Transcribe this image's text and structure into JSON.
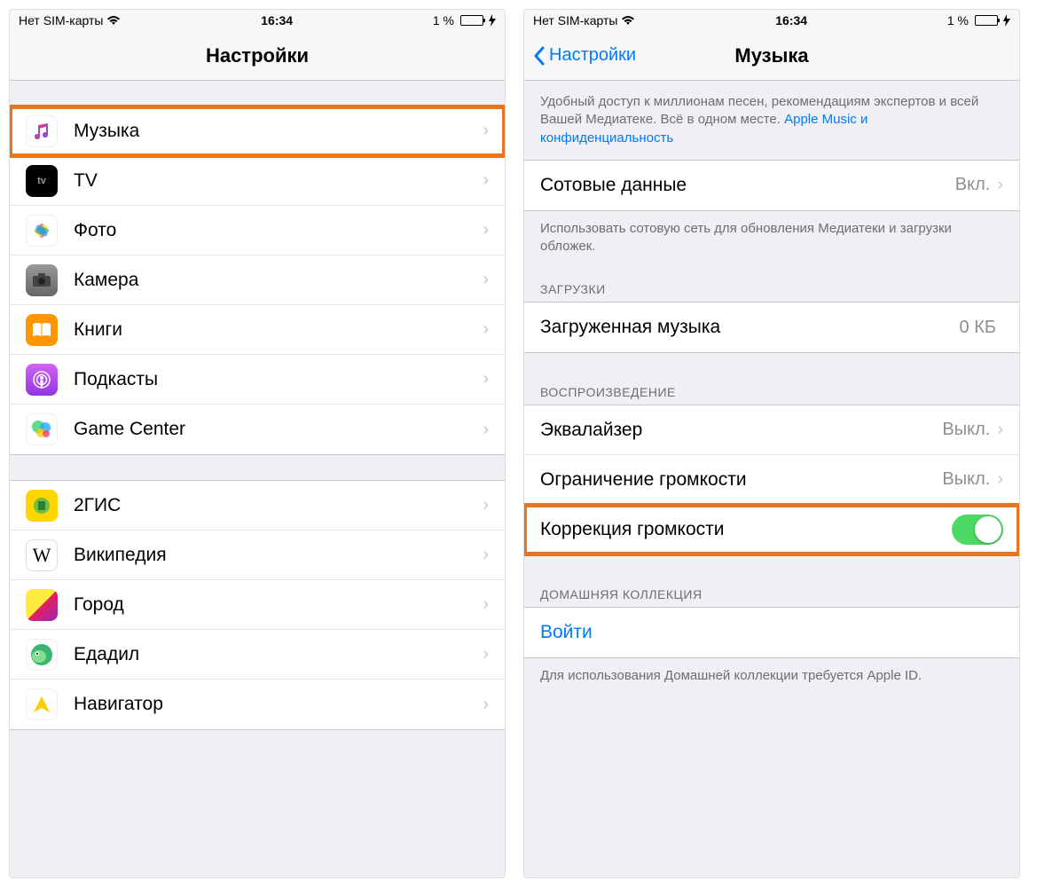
{
  "status": {
    "carrier": "Нет SIM-карты",
    "time": "16:34",
    "battery_pct": "1 %"
  },
  "left": {
    "title": "Настройки",
    "group1": [
      {
        "label": "Музыка",
        "icon": "music"
      },
      {
        "label": "TV",
        "icon": "tv"
      },
      {
        "label": "Фото",
        "icon": "photos"
      },
      {
        "label": "Камера",
        "icon": "camera"
      },
      {
        "label": "Книги",
        "icon": "books"
      },
      {
        "label": "Подкасты",
        "icon": "podcasts"
      },
      {
        "label": "Game Center",
        "icon": "gamecenter"
      }
    ],
    "group2": [
      {
        "label": "2ГИС",
        "icon": "2gis"
      },
      {
        "label": "Википедия",
        "icon": "wikipedia"
      },
      {
        "label": "Город",
        "icon": "gorod"
      },
      {
        "label": "Едадил",
        "icon": "edadil"
      },
      {
        "label": "Навигатор",
        "icon": "navigator"
      }
    ]
  },
  "right": {
    "back": "Настройки",
    "title": "Музыка",
    "intro_text": "Удобный доступ к миллионам песен, рекомендациям экспертов и всей Вашей Медиатеке. Всё в одном месте. ",
    "intro_link": "Apple Music и конфиденциальность",
    "cellular": {
      "label": "Сотовые данные",
      "value": "Вкл."
    },
    "cellular_footer": "Использовать сотовую сеть для обновления Медиатеки и загрузки обложек.",
    "downloads_header": "ЗАГРУЗКИ",
    "downloaded": {
      "label": "Загруженная музыка",
      "value": "0 КБ"
    },
    "playback_header": "ВОСПРОИЗВЕДЕНИЕ",
    "eq": {
      "label": "Эквалайзер",
      "value": "Выкл."
    },
    "volume_limit": {
      "label": "Ограничение громкости",
      "value": "Выкл."
    },
    "sound_check": {
      "label": "Коррекция громкости"
    },
    "home_header": "ДОМАШНЯЯ КОЛЛЕКЦИЯ",
    "signin": "Войти",
    "home_footer": "Для использования Домашней коллекции требуется Apple ID."
  }
}
